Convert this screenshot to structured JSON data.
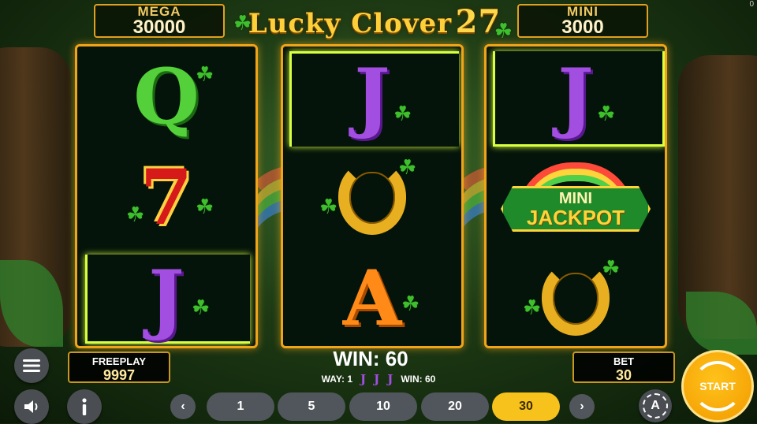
{
  "jackpots": {
    "mega": {
      "label": "MEGA",
      "value": "30000"
    },
    "mini": {
      "label": "MINI",
      "value": "3000"
    }
  },
  "logo": {
    "line1": "Lucky Clover",
    "number": "27"
  },
  "corner_text": "0",
  "reels": [
    [
      "Q",
      "7",
      "J"
    ],
    [
      "J",
      "horseshoe",
      "A"
    ],
    [
      "J",
      "mini-jackpot",
      "horseshoe"
    ]
  ],
  "jackpot_badge": {
    "top": "MINI",
    "main": "JACKPOT"
  },
  "freeplay": {
    "label": "FREEPLAY",
    "value": "9997"
  },
  "bet": {
    "label": "BET",
    "value": "30"
  },
  "win": {
    "main": "WIN: 60",
    "way_label": "WAY: 1",
    "line_symbol": "J",
    "line_win": "WIN: 60"
  },
  "bet_options": [
    "1",
    "5",
    "10",
    "20",
    "30"
  ],
  "selected_bet": "30",
  "controls": {
    "start_label": "START",
    "auto_label": "A",
    "prev_icon": "chevron-left-icon",
    "next_icon": "chevron-right-icon"
  },
  "colors": {
    "accent": "#f6c21b",
    "frame": "#f0a418",
    "clover_green": "#3fbf2e"
  }
}
